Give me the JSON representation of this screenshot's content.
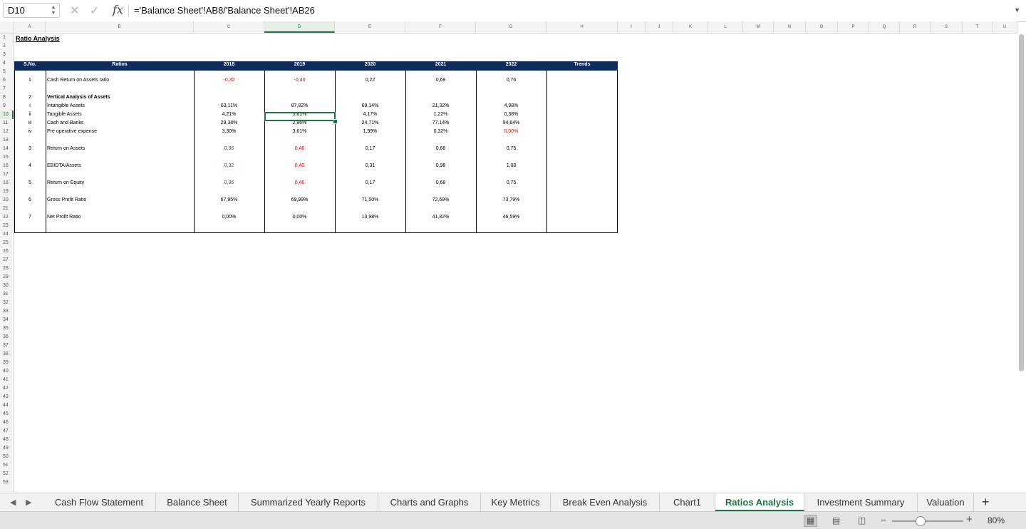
{
  "formula_bar": {
    "name_box": "D10",
    "formula": "='Balance Sheet'!AB8/'Balance Sheet'!AB26",
    "cancel_icon": "close-icon",
    "enter_icon": "check-icon",
    "fx_label": "fx"
  },
  "columns": [
    "A",
    "B",
    "C",
    "D",
    "E",
    "F",
    "G",
    "H",
    "I",
    "J",
    "K",
    "L",
    "M",
    "N",
    "O",
    "P",
    "Q",
    "R",
    "S",
    "T",
    "U"
  ],
  "selected_column": "D",
  "selected_row": "10",
  "rows": [
    "1",
    "2",
    "3",
    "4",
    "5",
    "6",
    "7",
    "8",
    "9",
    "10",
    "11",
    "12",
    "13",
    "14",
    "15",
    "16",
    "17",
    "18",
    "19",
    "20",
    "21",
    "22",
    "23",
    "24",
    "25",
    "26",
    "27",
    "28",
    "29",
    "30",
    "31",
    "32",
    "33",
    "34",
    "35",
    "36",
    "37",
    "38",
    "39",
    "40",
    "41",
    "42",
    "43",
    "44",
    "45",
    "46",
    "47",
    "48",
    "49",
    "50",
    "51",
    "52",
    "53"
  ],
  "sheet": {
    "title": "Ratio Analysis",
    "headers": {
      "sno": "S.No.",
      "ratios": "Ratios",
      "years": [
        "2018",
        "2019",
        "2020",
        "2021",
        "2022"
      ],
      "trends": "Trends"
    },
    "rows": [
      {
        "no": "1",
        "label": "Cash Return on Assets ratio",
        "values": [
          "-0,32",
          "-0,40",
          "0,22",
          "0,69",
          "0,76"
        ],
        "neg": [
          true,
          true,
          false,
          false,
          false
        ]
      },
      {
        "no": "2",
        "label": "Vertical Analysis of Assets",
        "bold": true,
        "values": [
          "",
          "",
          "",
          "",
          ""
        ],
        "neg": [
          false,
          false,
          false,
          false,
          false
        ]
      },
      {
        "no": "i",
        "label": "Intangible Assets",
        "values": [
          "63,11%",
          "87,82%",
          "69,14%",
          "21,32%",
          "4,98%"
        ],
        "neg": [
          false,
          false,
          false,
          false,
          false
        ]
      },
      {
        "no": "ii",
        "label": "Tangible Assets",
        "values": [
          "4,21%",
          "5,61%",
          "4,17%",
          "1,22%",
          "0,38%"
        ],
        "neg": [
          false,
          false,
          false,
          false,
          false
        ]
      },
      {
        "no": "iii",
        "label": "Cash and Banks",
        "values": [
          "29,38%",
          "2,96%",
          "24,71%",
          "77,14%",
          "94,64%"
        ],
        "neg": [
          false,
          false,
          false,
          false,
          false
        ]
      },
      {
        "no": "iv",
        "label": "Pre operative expense",
        "values": [
          "3,30%",
          "3,61%",
          "1,99%",
          "0,32%",
          "0,00%"
        ],
        "neg": [
          false,
          false,
          false,
          false,
          true
        ]
      },
      {
        "no": "3",
        "label": "Return on Assets",
        "values": [
          "0,36",
          "0,46",
          "0,17",
          "0,68",
          "0,75"
        ],
        "neg": [
          true,
          true,
          false,
          false,
          false
        ]
      },
      {
        "no": "4",
        "label": "EBIDTA/Assets",
        "values": [
          "0,32",
          "0,40",
          "0,31",
          "0,98",
          "1,08"
        ],
        "neg": [
          true,
          true,
          false,
          false,
          false
        ]
      },
      {
        "no": "5",
        "label": "Return on Equity",
        "values": [
          "0,36",
          "0,46",
          "0,17",
          "0,68",
          "0,75"
        ],
        "neg": [
          true,
          true,
          false,
          false,
          false
        ]
      },
      {
        "no": "6",
        "label": "Gross Profit Ratio",
        "values": [
          "67,95%",
          "69,99%",
          "71,50%",
          "72,69%",
          "73,79%"
        ],
        "neg": [
          false,
          false,
          false,
          false,
          false
        ]
      },
      {
        "no": "7",
        "label": "Net Profit Ratio",
        "values": [
          "0,00%",
          "0,00%",
          "13,98%",
          "41,82%",
          "46,59%"
        ],
        "neg": [
          false,
          false,
          false,
          false,
          false
        ]
      }
    ]
  },
  "tabs": {
    "items": [
      "Cash Flow Statement",
      "Balance Sheet",
      "Summarized Yearly Reports",
      "Charts and Graphs",
      "Key Metrics",
      "Break Even Analysis",
      "Chart1",
      "Ratios Analysis",
      "Investment Summary",
      "Valuation"
    ],
    "active": "Ratios Analysis",
    "add_label": "+"
  },
  "status_bar": {
    "zoom": "80%",
    "zoom_percent": 80,
    "minus": "−",
    "plus": "+"
  },
  "colors": {
    "header_band": "#0f2b5b",
    "accent": "#217346",
    "negative": "#e00000"
  }
}
